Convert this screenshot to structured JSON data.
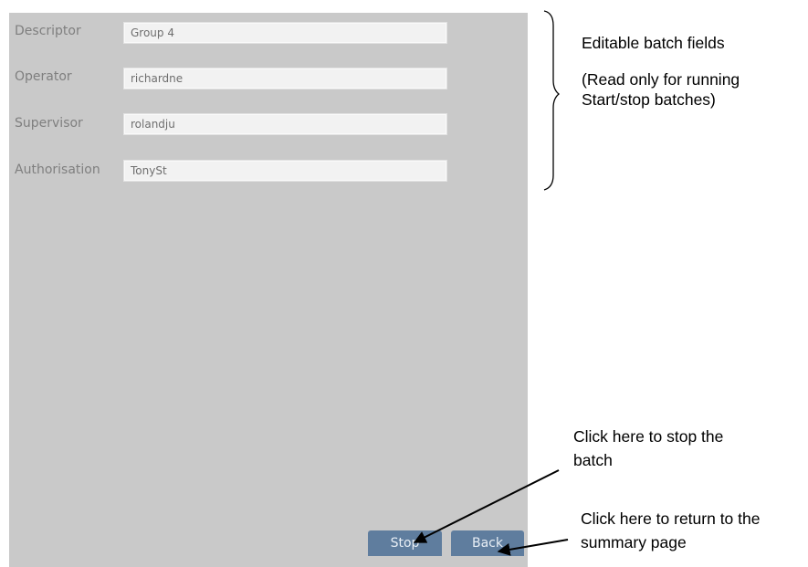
{
  "form": {
    "fields": [
      {
        "label": "Descriptor",
        "value": "Group 4"
      },
      {
        "label": "Operator",
        "value": "richardne"
      },
      {
        "label": "Supervisor",
        "value": "rolandju"
      },
      {
        "label": "Authorisation",
        "value": "TonySt"
      }
    ],
    "stop_label": "Stop",
    "back_label": "Back"
  },
  "annotations": {
    "editable_title": "Editable batch fields",
    "readonly_line1": "(Read only for running",
    "readonly_line2": "Start/stop batches)",
    "stop_line1": "Click here to stop the",
    "stop_line2": "batch",
    "back_line1": "Click here to return to the",
    "back_line2": "summary page"
  }
}
